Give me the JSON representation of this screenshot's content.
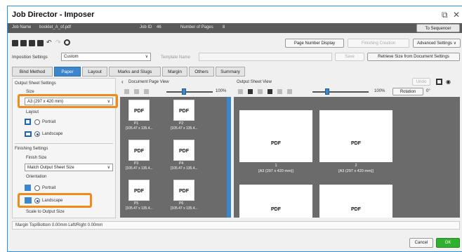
{
  "window": {
    "title": "Job Director - Imposer",
    "job_name_label": "Job Name",
    "job_name_value": "booklet_A_of.pdf",
    "job_id_label": "Job ID",
    "job_id_value": "46",
    "pages_label": "Number of Pages",
    "pages_value": "8",
    "to_sequencer": "To Sequencer"
  },
  "toolbar": {
    "page_number_display": "Page Number Display",
    "finishing_creation": "Finishing Creation",
    "advanced_settings": "Advanced Settings",
    "imposition_settings_label": "Imposition Settings",
    "imposition_settings_value": "Custom",
    "template_name_label": "Template Name",
    "template_name_value": "",
    "save": "Save",
    "retrieve_size": "Retrieve Size from Document Settings"
  },
  "tabs": [
    "Bind Method",
    "Paper",
    "Layout",
    "Marks and Slugs",
    "Margin",
    "Others",
    "Summary"
  ],
  "left": {
    "output_sheet_settings": "Output Sheet Settings",
    "size_label": "Size",
    "size_value": "A3 (297 x 420 mm)",
    "layout_label": "Layout",
    "portrait": "Portrait",
    "landscape": "Landscape",
    "finishing_settings": "Finishing Settings",
    "finish_size_label": "Finish Size",
    "finish_size_value": "Match Output Sheet Size",
    "orientation_label": "Orientation",
    "portrait2": "Portrait",
    "landscape2": "Landscape",
    "scale_label": "Scale to Output Size"
  },
  "doc_view": {
    "title": "Document Page View",
    "zoom": "100%",
    "pages": [
      {
        "name": "P1",
        "size": "[105.47 x 135.4..."
      },
      {
        "name": "P2",
        "size": "[105.47 x 135.4..."
      },
      {
        "name": "P3",
        "size": "[105.47 x 135.4..."
      },
      {
        "name": "P4",
        "size": "[105.47 x 135.4..."
      },
      {
        "name": "P5",
        "size": "[105.47 x 135.4..."
      },
      {
        "name": "P6",
        "size": "[105.47 x 135.4..."
      }
    ],
    "pdf_text": "PDF"
  },
  "sheet_view": {
    "title": "Output Sheet View",
    "undo": "Undo",
    "zoom": "100%",
    "rotation": "Rotation",
    "rotation_value": "0°",
    "sheets": [
      {
        "num": "1",
        "size": "[A3 (297 x 420 mm)]"
      },
      {
        "num": "2",
        "size": "[A3 (297 x 420 mm)]"
      }
    ]
  },
  "status": {
    "margin_text": "Margin  Top/Bottom  0.00mm  Left/Right  0.00mm"
  },
  "footer": {
    "cancel": "Cancel",
    "ok": "OK"
  },
  "colors": {
    "accent": "#3a86cf",
    "highlight": "#f08a1a",
    "ok": "#2fb02f"
  }
}
